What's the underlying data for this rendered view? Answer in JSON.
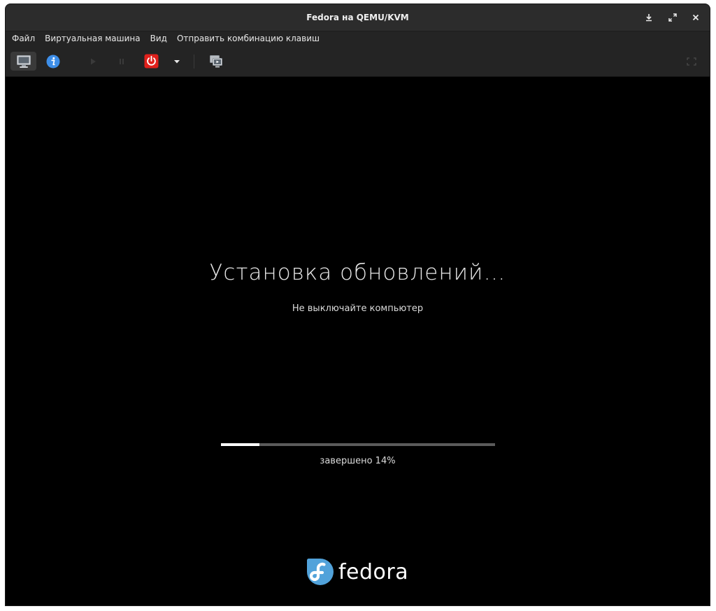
{
  "window": {
    "title": "Fedora на QEMU/KVM"
  },
  "menu": {
    "items": [
      {
        "label": "Файл"
      },
      {
        "label": "Виртуальная машина"
      },
      {
        "label": "Вид"
      },
      {
        "label": "Отправить комбинацию клавиш"
      }
    ]
  },
  "toolbar": {
    "icons": [
      "monitor-icon",
      "info-icon",
      "play-icon",
      "pause-icon",
      "power-icon",
      "chevron-down-icon",
      "snapshots-icon",
      "fullscreen-icon"
    ]
  },
  "screen": {
    "heading": "Установка обновлений…",
    "subheading": "Не выключайте компьютер",
    "progress_percent": 14,
    "progress_label": "завершено 14%",
    "logo_text": "fedora"
  },
  "colors": {
    "titlebar": "#2c2c2c",
    "toolbar": "#242424",
    "power_red": "#e0201b",
    "info_blue": "#3d8ee8",
    "fedora_blue": "#51a2da"
  }
}
